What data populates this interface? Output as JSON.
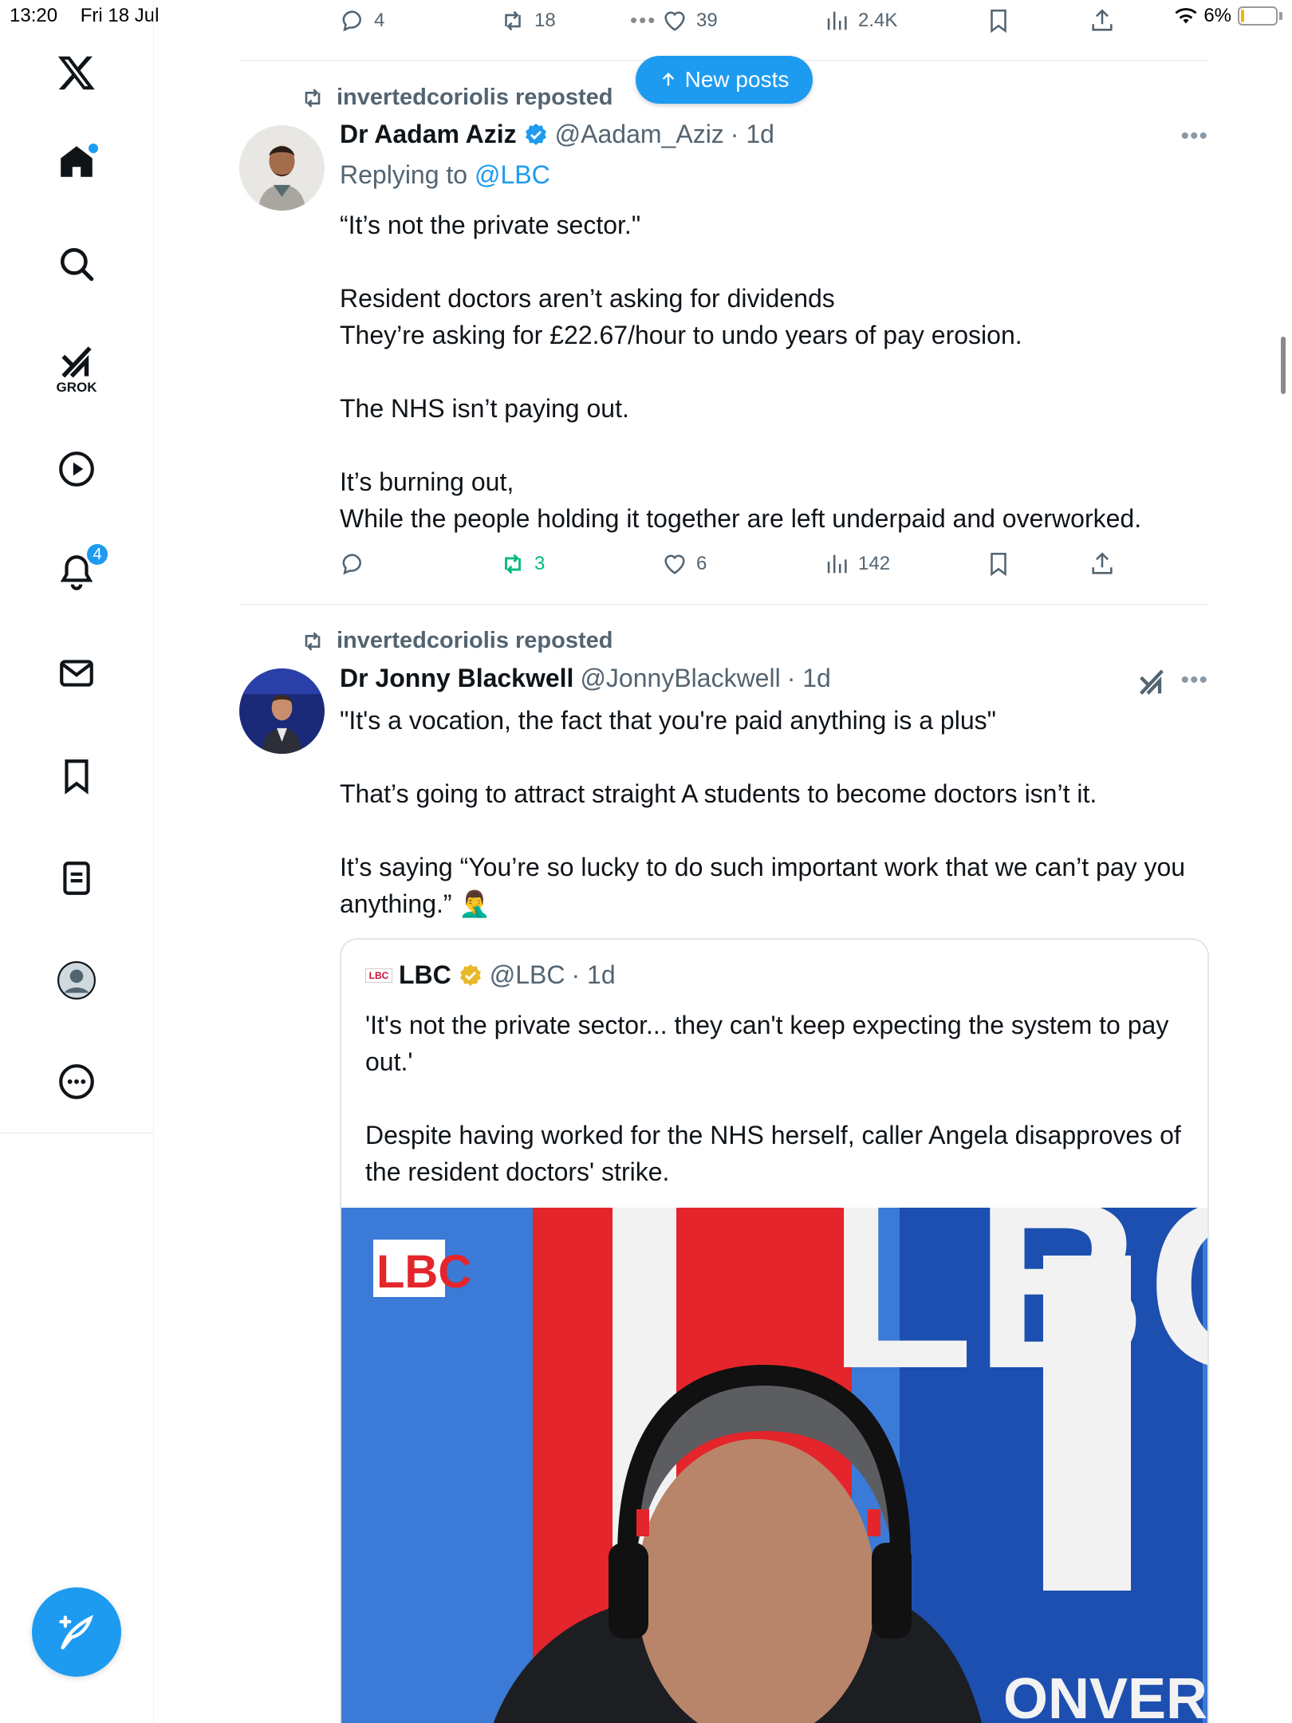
{
  "status_bar": {
    "time": "13:20",
    "date": "Fri 18 Jul",
    "battery": "6%"
  },
  "sidebar": {
    "grok_label": "GROK",
    "notifications_badge": "4",
    "items": [
      "home-icon",
      "search-icon",
      "grok-icon",
      "video-icon",
      "notifications-icon",
      "messages-icon",
      "bookmarks-icon",
      "lists-icon",
      "profile-icon",
      "more-icon"
    ]
  },
  "prev_tweet_actions": {
    "replies": "4",
    "reposts": "18",
    "likes": "39",
    "views": "2.4K"
  },
  "new_posts_label": "New posts",
  "tweet1": {
    "repost_by": "invertedcoriolis reposted",
    "name": "Dr Aadam Aziz",
    "handle": "@Aadam_Aziz",
    "time": "· 1d",
    "replying_prefix": "Replying to ",
    "replying_handle": "@LBC",
    "paragraphs": [
      "“It’s not the private sector.\"",
      "Resident doctors aren’t asking for dividends\nThey’re asking for £22.67/hour to undo years of pay erosion.",
      "The NHS isn’t paying out.",
      "It’s burning out,\nWhile the people holding it together are left underpaid and overworked."
    ],
    "actions": {
      "replies": "",
      "reposts": "3",
      "likes": "6",
      "views": "142"
    }
  },
  "tweet2": {
    "repost_by": "invertedcoriolis reposted",
    "name": "Dr Jonny Blackwell",
    "handle": "@JonnyBlackwell",
    "time": "· 1d",
    "paragraphs": [
      "\"It's a vocation, the fact that you're paid anything is a plus\"",
      "That’s going to attract straight A students to become doctors isn’t it.",
      "It’s saying “You’re so lucky to do such important work that we can’t pay you anything.” 🤦‍♂️"
    ],
    "quote": {
      "logo_text": "LBC",
      "name": "LBC",
      "handle": "@LBC",
      "time": "· 1d",
      "paragraphs": [
        "'It's not the private sector... they can't keep expecting the system to pay out.'",
        "Despite having worked for the NHS herself, caller Angela disapproves of the resident doctors' strike."
      ],
      "media_logo": "LBC",
      "media_bg_text": "LBC",
      "media_banner_text": "ONVERSA"
    }
  },
  "colors": {
    "accent": "#1d9bf0",
    "repost_green": "#00ba7c",
    "muted": "#536471",
    "lbc_red": "#e4252b",
    "lbc_blue": "#2f6fd0"
  }
}
